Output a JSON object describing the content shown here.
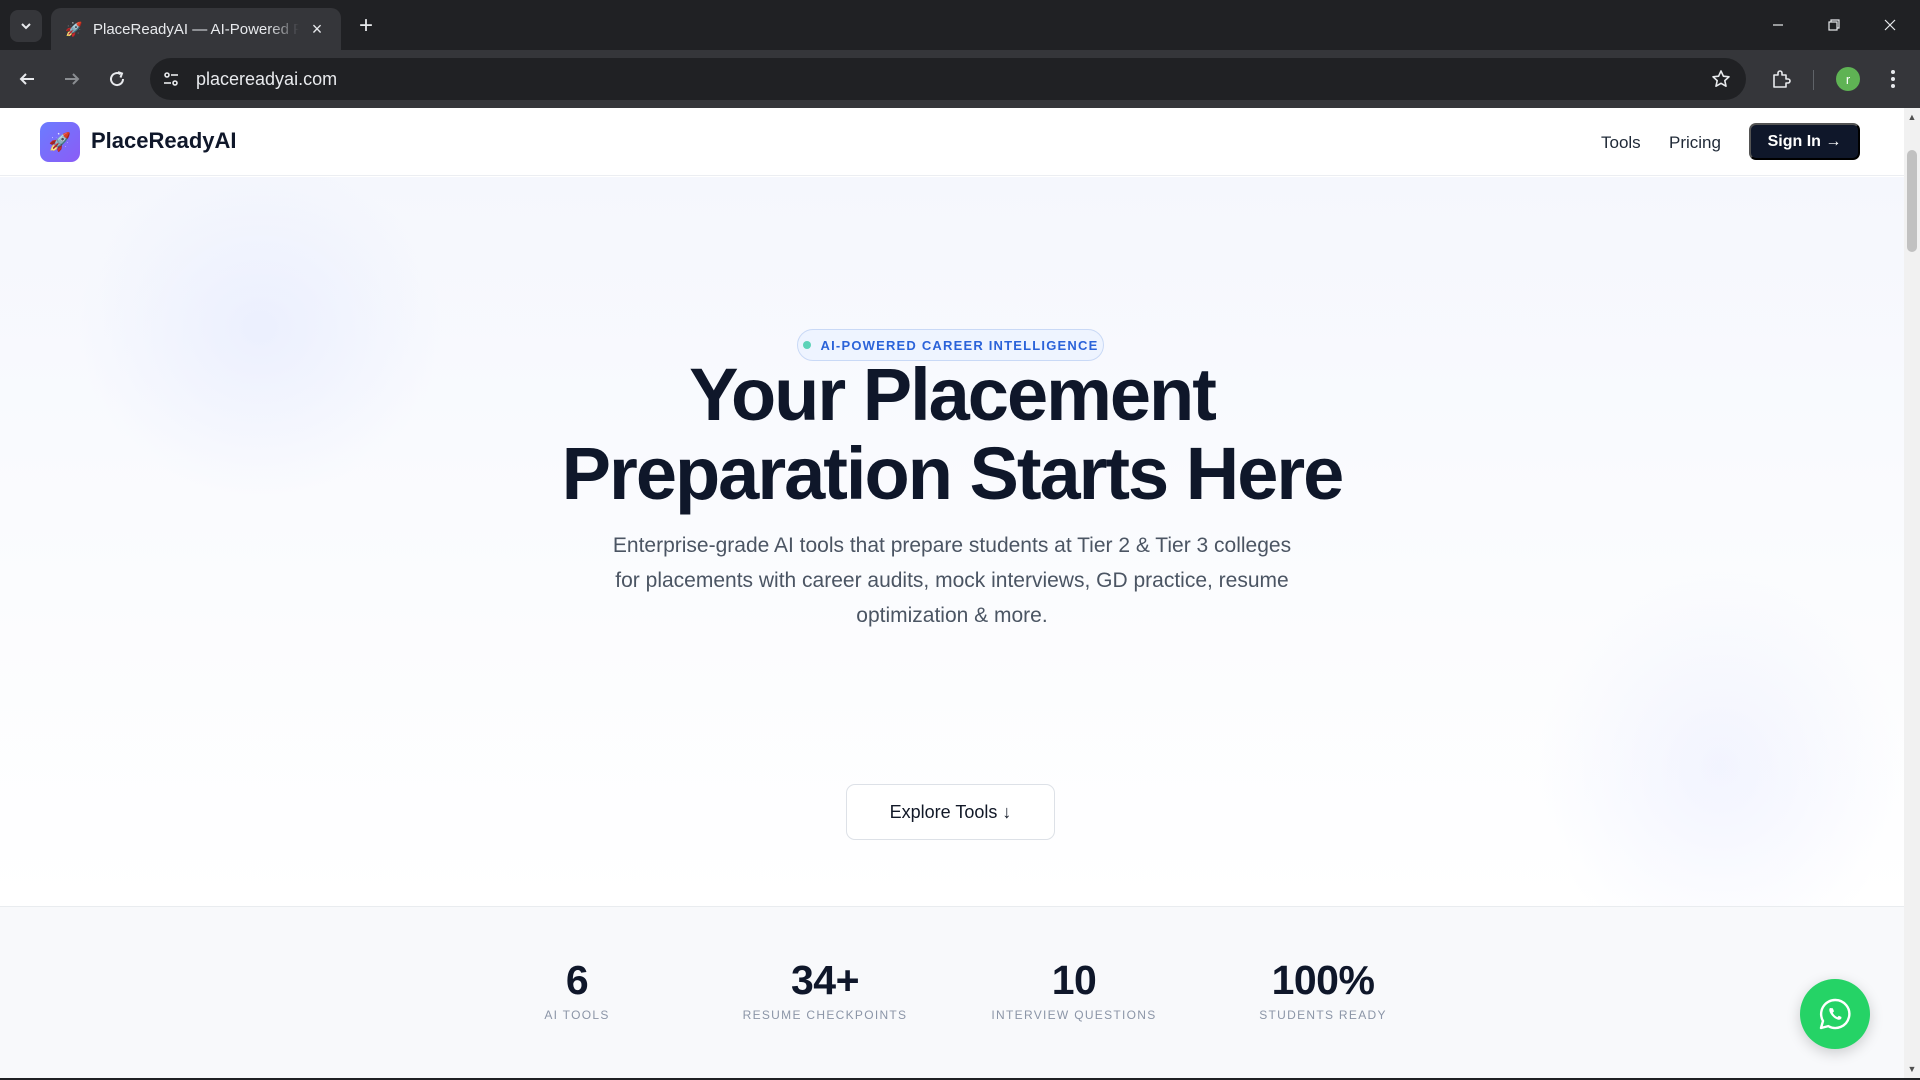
{
  "browser": {
    "tab_title": "PlaceReadyAI — AI-Powered Placement Preparation",
    "url": "placereadyai.com",
    "profile_initial": "r"
  },
  "header": {
    "brand": "PlaceReadyAI",
    "nav": {
      "tools": "Tools",
      "pricing": "Pricing"
    },
    "signin_label": "Sign In →"
  },
  "hero": {
    "badge": "AI-POWERED CAREER INTELLIGENCE",
    "title_line1": "Your Placement",
    "title_line2": "Preparation Starts Here",
    "subtitle": "Enterprise-grade AI tools that prepare students at Tier 2 & Tier 3 colleges for placements with career audits, mock interviews, GD practice, resume optimization & more.",
    "cta_label": "Explore Tools ↓"
  },
  "stats": [
    {
      "value": "6",
      "label": "AI TOOLS"
    },
    {
      "value": "34+",
      "label": "RESUME CHECKPOINTS"
    },
    {
      "value": "10",
      "label": "INTERVIEW QUESTIONS"
    },
    {
      "value": "100%",
      "label": "STUDENTS READY"
    }
  ],
  "colors": {
    "brand_dark": "#0f172a",
    "badge_blue": "#2b63d9",
    "whatsapp_green": "#25d366",
    "logo_gradient_start": "#6b7cff",
    "logo_gradient_end": "#8b5cf6"
  },
  "icons": {
    "tab_search": "chevron-down-icon",
    "favicon": "rocket-icon",
    "back": "arrow-left-icon",
    "forward": "arrow-right-icon",
    "reload": "reload-icon",
    "site_info": "tune-icon",
    "bookmark": "star-icon",
    "extensions": "puzzle-icon",
    "menu": "kebab-icon",
    "logo": "rocket-icon",
    "chat": "whatsapp-icon"
  }
}
